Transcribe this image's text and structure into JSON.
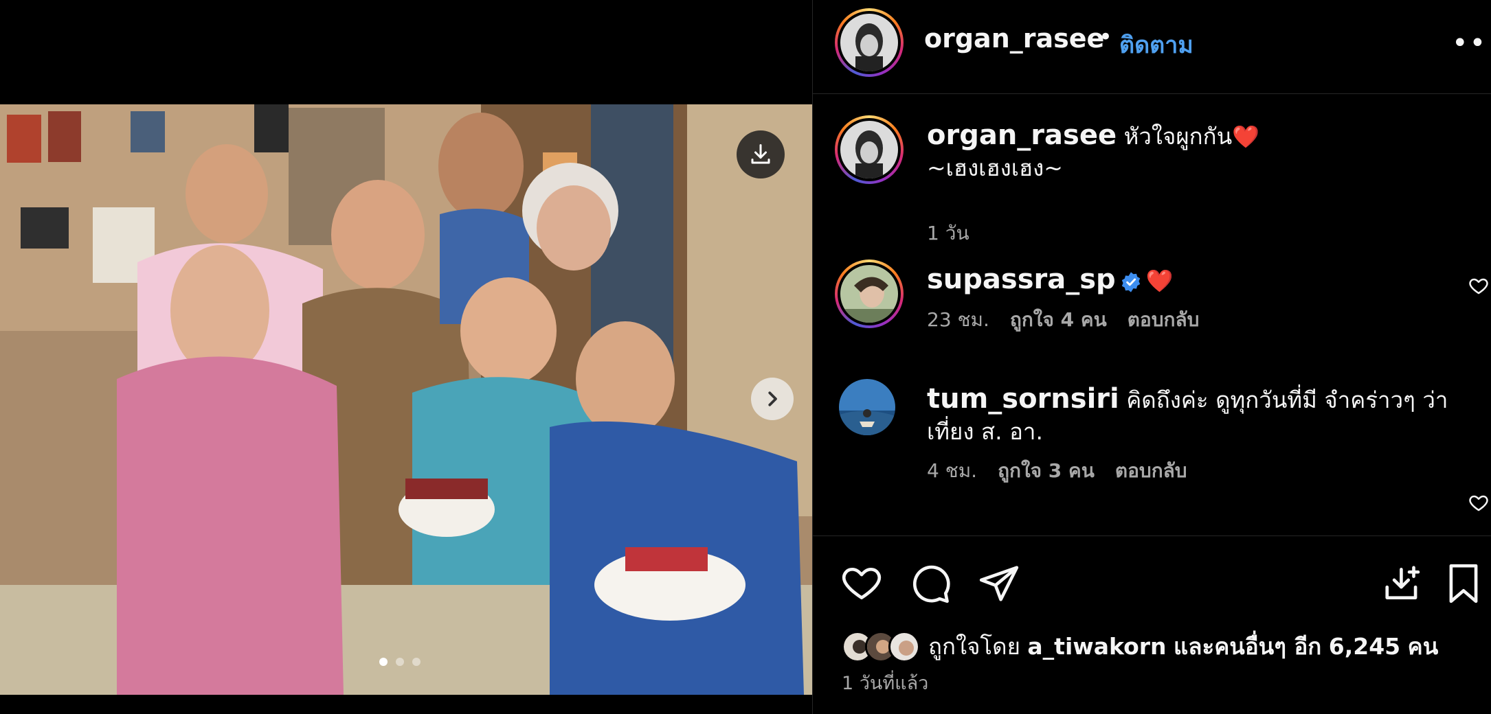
{
  "post": {
    "author": "organ_rasee",
    "separator": "•",
    "follow_label": "ติดตาม",
    "more_label": "•••"
  },
  "caption": {
    "username": "organ_rasee",
    "text_line1": "หัวใจผูกกัน",
    "heart_emoji": "❤️",
    "text_line2": "~เฮงเฮงเฮง~",
    "time": "1 วัน"
  },
  "comments": [
    {
      "username": "supassra_sp",
      "verified": true,
      "text": "❤️",
      "time": "23 ชม.",
      "likes": "ถูกใจ 4 คน",
      "reply_label": "ตอบกลับ"
    },
    {
      "username": "tum_sornsiri",
      "verified": false,
      "text": "คิดถึงค่ะ ดูทุกวันที่มี จำคร่าวๆ ว่าเที่ยง ส. อา.",
      "time": "4 ชม.",
      "likes": "ถูกใจ 3 คน",
      "reply_label": "ตอบกลับ"
    }
  ],
  "carousel": {
    "count": 3,
    "active_index": 0
  },
  "likes_summary": {
    "prefix": "ถูกใจโดย",
    "user": "a_tiwakorn",
    "middle": "และคนอื่นๆ อีก",
    "count": "6,245",
    "suffix": "คน"
  },
  "posted_ago": "1 วันที่แล้ว",
  "colors": {
    "background": "#000000",
    "text": "#f5f5f5",
    "muted": "#a8a8a8",
    "follow": "#4fa0f0",
    "verified": "#3d8ef0",
    "heart": "#ff3040"
  },
  "icons": {
    "download": "download-icon",
    "next": "chevron-right-icon",
    "like": "heart-icon",
    "comment": "comment-icon",
    "share": "send-icon",
    "save_download": "download-tray-icon",
    "bookmark": "bookmark-icon"
  }
}
